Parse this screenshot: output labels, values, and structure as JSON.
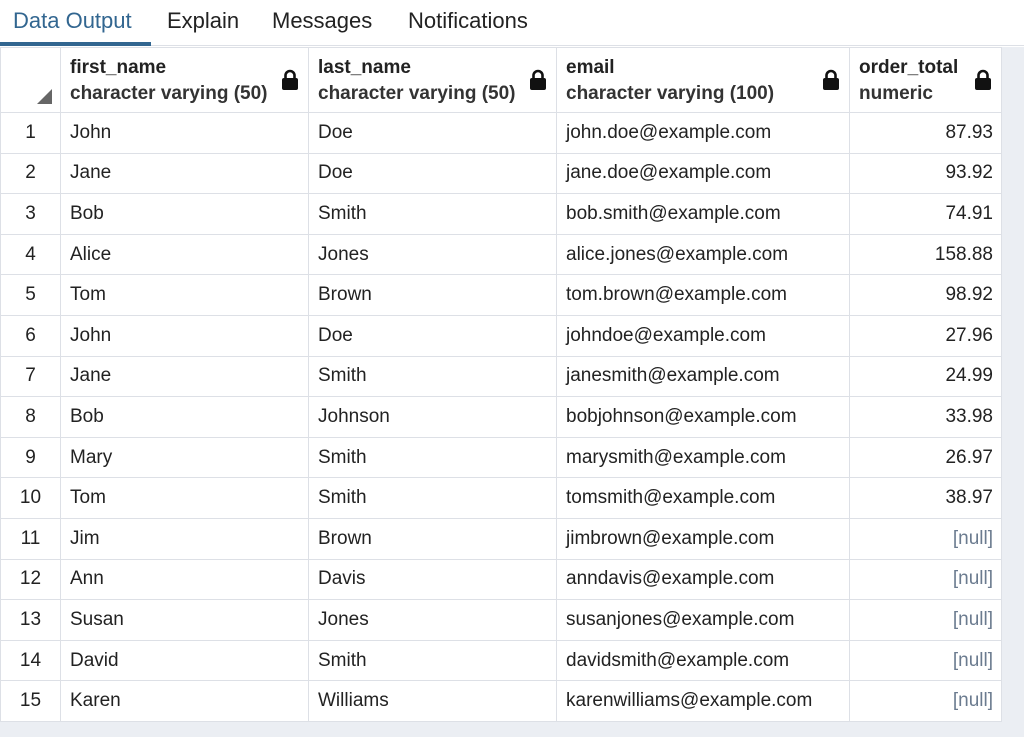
{
  "tabs": [
    {
      "label": "Data Output"
    },
    {
      "label": "Explain"
    },
    {
      "label": "Messages"
    },
    {
      "label": "Notifications"
    }
  ],
  "columns": [
    {
      "name": "first_name",
      "type": "character varying (50)"
    },
    {
      "name": "last_name",
      "type": "character varying (50)"
    },
    {
      "name": "email",
      "type": "character varying (100)"
    },
    {
      "name": "order_total",
      "type": "numeric"
    }
  ],
  "rows": [
    [
      "1",
      "John",
      "Doe",
      "john.doe@example.com",
      "87.93"
    ],
    [
      "2",
      "Jane",
      "Doe",
      "jane.doe@example.com",
      "93.92"
    ],
    [
      "3",
      "Bob",
      "Smith",
      "bob.smith@example.com",
      "74.91"
    ],
    [
      "4",
      "Alice",
      "Jones",
      "alice.jones@example.com",
      "158.88"
    ],
    [
      "5",
      "Tom",
      "Brown",
      "tom.brown@example.com",
      "98.92"
    ],
    [
      "6",
      "John",
      "Doe",
      "johndoe@example.com",
      "27.96"
    ],
    [
      "7",
      "Jane",
      "Smith",
      "janesmith@example.com",
      "24.99"
    ],
    [
      "8",
      "Bob",
      "Johnson",
      "bobjohnson@example.com",
      "33.98"
    ],
    [
      "9",
      "Mary",
      "Smith",
      "marysmith@example.com",
      "26.97"
    ],
    [
      "10",
      "Tom",
      "Smith",
      "tomsmith@example.com",
      "38.97"
    ],
    [
      "11",
      "Jim",
      "Brown",
      "jimbrown@example.com",
      "[null]"
    ],
    [
      "12",
      "Ann",
      "Davis",
      "anndavis@example.com",
      "[null]"
    ],
    [
      "13",
      "Susan",
      "Jones",
      "susanjones@example.com",
      "[null]"
    ],
    [
      "14",
      "David",
      "Smith",
      "davidsmith@example.com",
      "[null]"
    ],
    [
      "15",
      "Karen",
      "Williams",
      "karenwilliams@example.com",
      "[null]"
    ]
  ],
  "icons": {
    "column_lock": "lock-icon",
    "select_all": "select-all-corner-icon"
  },
  "colors": {
    "accent": "#326690",
    "null_text": "#6b7b8f"
  }
}
